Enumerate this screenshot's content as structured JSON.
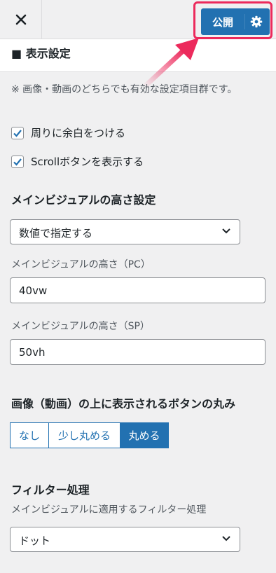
{
  "header": {
    "publish_label": "公開",
    "close_icon": "close-icon",
    "settings_icon": "gear-icon",
    "accent_color": "#2271b1",
    "highlight_color": "#ec2a5c"
  },
  "section": {
    "title": "■ 表示設定",
    "note": "※ 画像・動画のどちらでも有効な設定項目群です。",
    "checkboxes": [
      {
        "label": "周りに余白をつける",
        "checked": true
      },
      {
        "label": "Scrollボタンを表示する",
        "checked": true
      }
    ],
    "height_setting": {
      "heading": "メインビジュアルの高さ設定",
      "mode_value": "数値で指定する",
      "pc_label": "メインビジュアルの高さ（PC）",
      "pc_value": "40vw",
      "sp_label": "メインビジュアルの高さ（SP）",
      "sp_value": "50vh"
    },
    "button_round": {
      "heading": "画像（動画）の上に表示されるボタンの丸み",
      "options": [
        "なし",
        "少し丸める",
        "丸める"
      ],
      "selected": "丸める"
    },
    "filter": {
      "heading": "フィルター処理",
      "description": "メインビジュアルに適用するフィルター処理",
      "value": "ドット"
    }
  }
}
